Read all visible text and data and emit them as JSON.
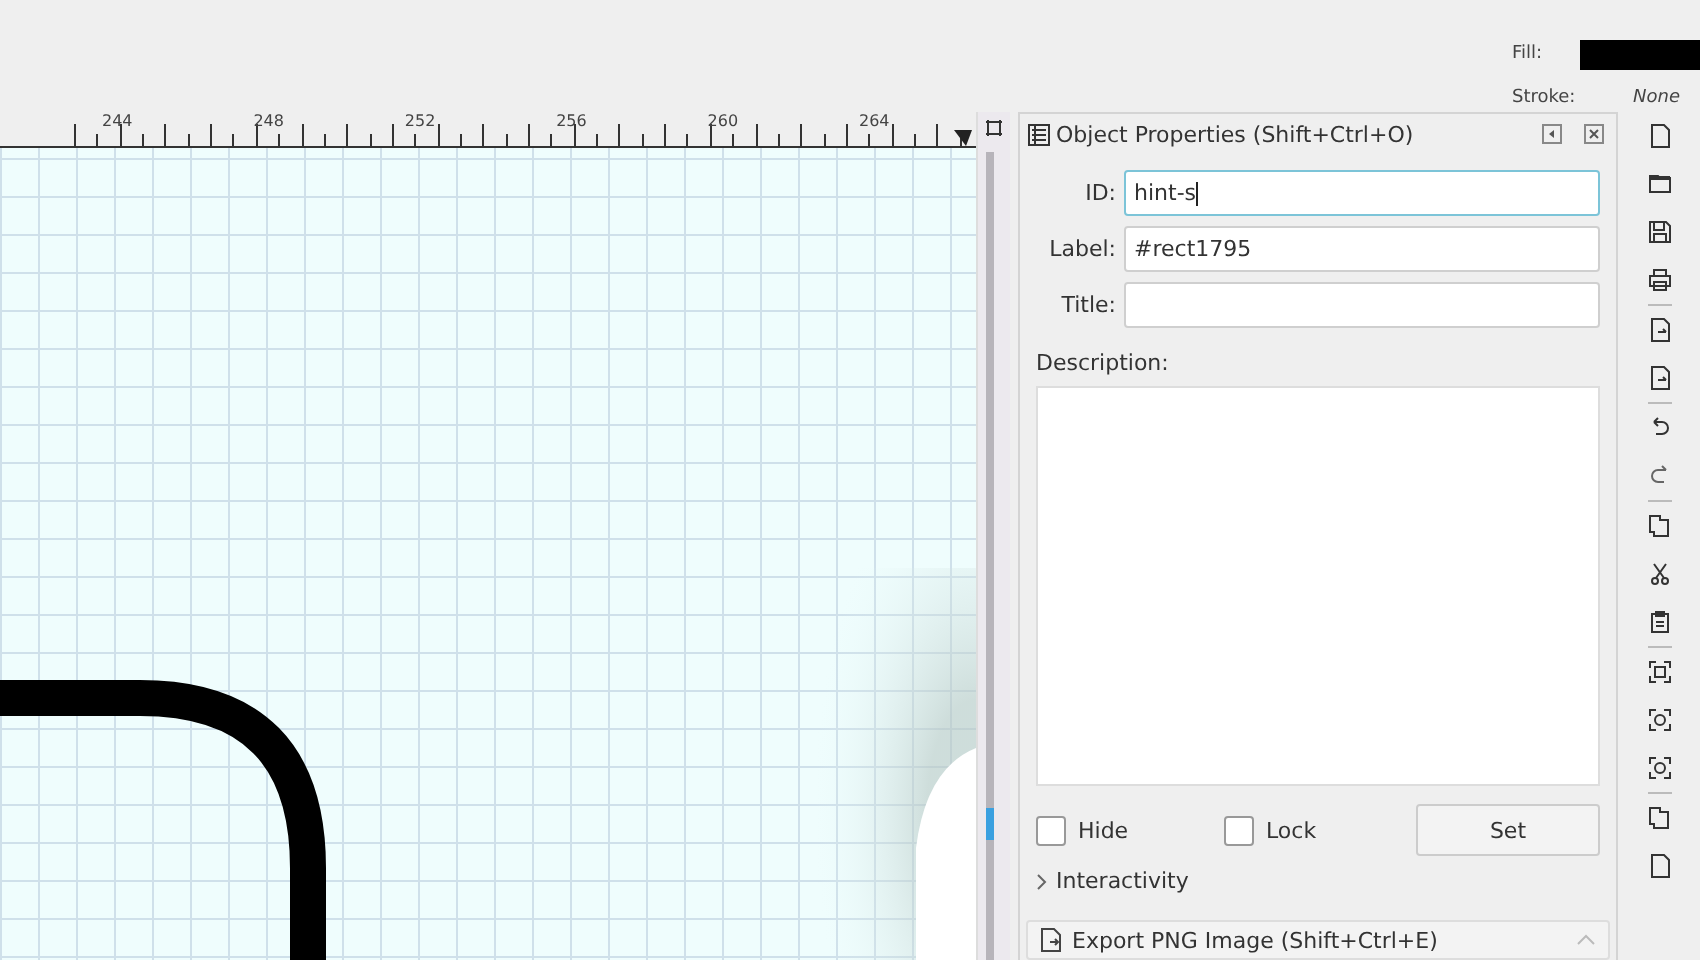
{
  "style_indicator": {
    "fill_label": "Fill:",
    "stroke_label": "Stroke:",
    "stroke_value": "None"
  },
  "ruler": {
    "labels": [
      "244",
      "248",
      "252",
      "256",
      "260",
      "264"
    ]
  },
  "panel": {
    "title": "Object Properties (Shift+Ctrl+O)",
    "fields": [
      {
        "label": "ID:",
        "value": "hint-s",
        "focused": true
      },
      {
        "label": "Label:",
        "value": "#rect1795",
        "focused": false
      },
      {
        "label": "Title:",
        "focused": false
      }
    ],
    "description_label": "Description:",
    "checkboxes": [
      {
        "label": "Hide",
        "checked": false
      },
      {
        "label": "Lock",
        "checked": false
      }
    ],
    "set_button": "Set",
    "expander": {
      "label": "Interactivity",
      "expanded": false
    }
  },
  "next_panel": {
    "title": "Export PNG Image (Shift+Ctrl+E)"
  }
}
